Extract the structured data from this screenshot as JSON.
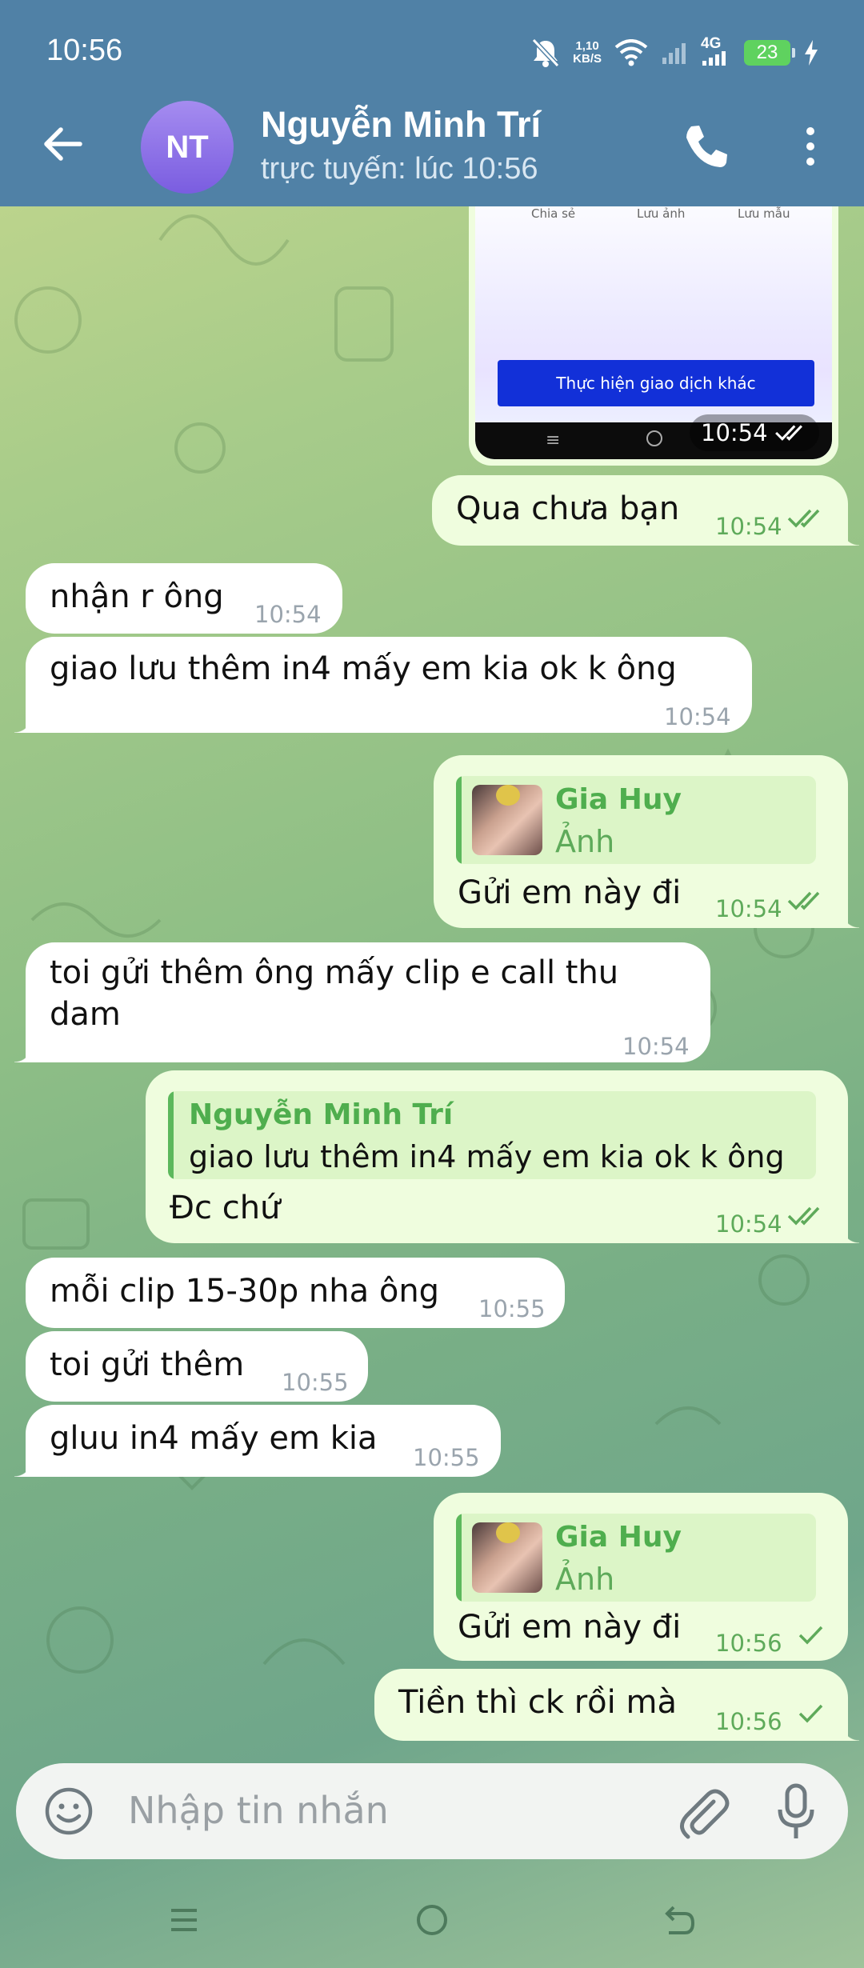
{
  "status_bar": {
    "time": "10:56",
    "net_speed_value": "1,10",
    "net_speed_unit": "KB/S",
    "network": "4G",
    "battery": "23"
  },
  "header": {
    "avatar_initials": "NT",
    "name": "Nguyễn Minh Trí",
    "status": "trực tuyến: lúc 10:56"
  },
  "image_message": {
    "labels": [
      "Chia sẻ",
      "Lưu ảnh",
      "Lưu mẫu"
    ],
    "button_text": "Thực hiện giao dịch khác",
    "time": "10:54"
  },
  "messages": [
    {
      "dir": "out",
      "text": "Qua chưa bạn",
      "time": "10:54",
      "read": true
    },
    {
      "dir": "in",
      "text": "nhận r ông",
      "time": "10:54"
    },
    {
      "dir": "in",
      "text": "giao lưu thêm in4 mấy em kia ok k ông",
      "time": "10:54"
    },
    {
      "dir": "out",
      "reply_name": "Gia Huy",
      "reply_text": "Ảnh",
      "text": "Gửi em này đi",
      "time": "10:54",
      "read": true
    },
    {
      "dir": "in",
      "text_lines": [
        "toi gửi thêm ông mấy clip e call thu",
        "dam"
      ],
      "time": "10:54"
    },
    {
      "dir": "out",
      "reply_name": "Nguyễn Minh Trí",
      "reply_text": "giao lưu thêm in4 mấy em kia ok k ông",
      "text": "Đc chứ",
      "time": "10:54",
      "read": true
    },
    {
      "dir": "in",
      "text": "mỗi clip 15-30p nha ông",
      "time": "10:55"
    },
    {
      "dir": "in",
      "text": "toi gửi thêm",
      "time": "10:55"
    },
    {
      "dir": "in",
      "text": "gluu in4 mấy em kia",
      "time": "10:55"
    },
    {
      "dir": "out",
      "reply_name": "Gia Huy",
      "reply_text": "Ảnh",
      "text": "Gửi em này đi",
      "time": "10:56",
      "read": false
    },
    {
      "dir": "out",
      "text": "Tiền thì ck rồi mà",
      "time": "10:56",
      "read": false
    }
  ],
  "input": {
    "placeholder": "Nhập tin nhắn"
  },
  "icons": {
    "back": "arrow-left-icon",
    "call": "phone-icon",
    "more": "more-vertical-icon",
    "emoji": "smile-icon",
    "attach": "paperclip-icon",
    "mic": "microphone-icon"
  },
  "colors": {
    "header": "#5081a6",
    "outgoing_bubble": "#effdde",
    "incoming_bubble": "#ffffff",
    "accent_green": "#4fae4e"
  }
}
